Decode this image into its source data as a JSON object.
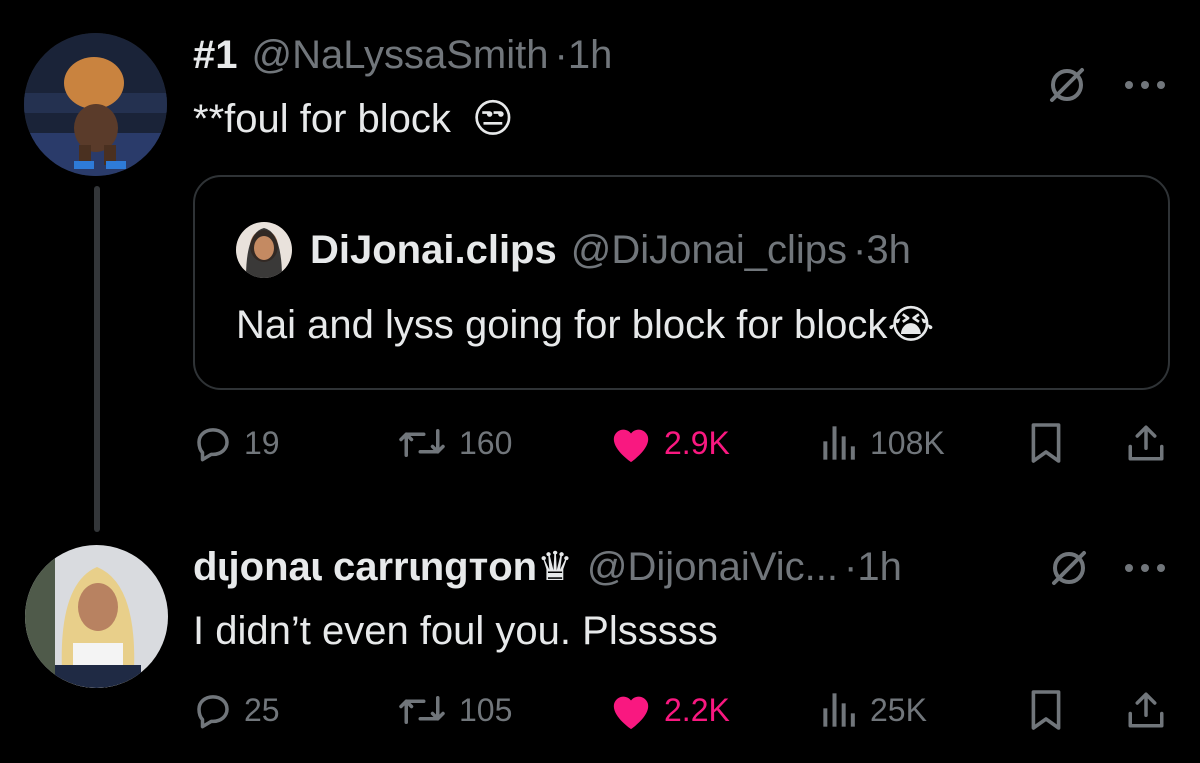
{
  "post1": {
    "rank": "#1",
    "handle": "@NaLyssaSmith",
    "dot": "·",
    "time": "1h",
    "text": "**foul for block",
    "emoji": "😒",
    "quote": {
      "name": "DiJonai.clips",
      "handle": "@DiJonai_clips",
      "dot": "·",
      "time": "3h",
      "text": "Nai and lyss going for block for block",
      "emoji": "😭"
    },
    "stats": {
      "replies": "19",
      "reposts": "160",
      "likes": "2.9K",
      "views": "108K"
    }
  },
  "post2": {
    "name": "dɩjonaɩ carrɩngтon♛",
    "handle": "@DijonaiVic...",
    "dot": "·",
    "time": "1h",
    "text": "I didn’t even foul you. Plsssss",
    "stats": {
      "replies": "25",
      "reposts": "105",
      "likes": "2.2K",
      "views": "25K"
    }
  },
  "colors": {
    "background": "#000000",
    "text": "#e7e9ea",
    "muted": "#71767b",
    "like": "#f91880",
    "border": "#2f3336"
  },
  "icons": [
    "reply-icon",
    "repost-icon",
    "heart-icon",
    "views-icon",
    "bookmark-icon",
    "share-icon",
    "grok-icon",
    "more-icon"
  ]
}
